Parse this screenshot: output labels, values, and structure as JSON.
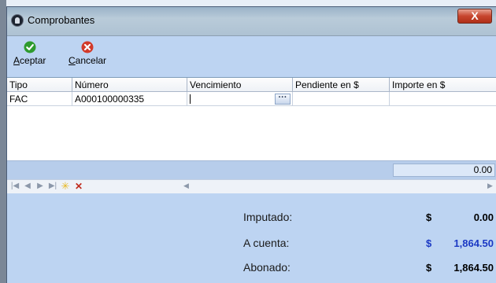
{
  "window": {
    "title": "Comprobantes",
    "close_label": "X"
  },
  "toolbar": {
    "accept_label_first": "A",
    "accept_label_rest": "ceptar",
    "cancel_label_first": "C",
    "cancel_label_rest": "ancelar",
    "accept_icon": "check-circle-icon",
    "cancel_icon": "x-circle-icon"
  },
  "grid": {
    "columns": [
      "Tipo",
      "Número",
      "Vencimiento",
      "Pendiente en $",
      "Importe en $"
    ],
    "rows": [
      {
        "tipo": "FAC",
        "numero": "A000100000335",
        "vencimiento": "",
        "pendiente": "",
        "importe": ""
      }
    ],
    "ellipsis_label": "···"
  },
  "totals": {
    "importe_total": "0.00"
  },
  "summary": {
    "imputado_label": "Imputado:",
    "imputado_currency": "$",
    "imputado_value": "0.00",
    "acuenta_label": "A cuenta:",
    "acuenta_currency": "$",
    "acuenta_value": "1,864.50",
    "abonado_label": "Abonado:",
    "abonado_currency": "$",
    "abonado_value": "1,864.50"
  },
  "colors": {
    "accept_green": "#2e9a2e",
    "cancel_red": "#d23a2a",
    "acuenta_blue": "#1b39c4"
  }
}
